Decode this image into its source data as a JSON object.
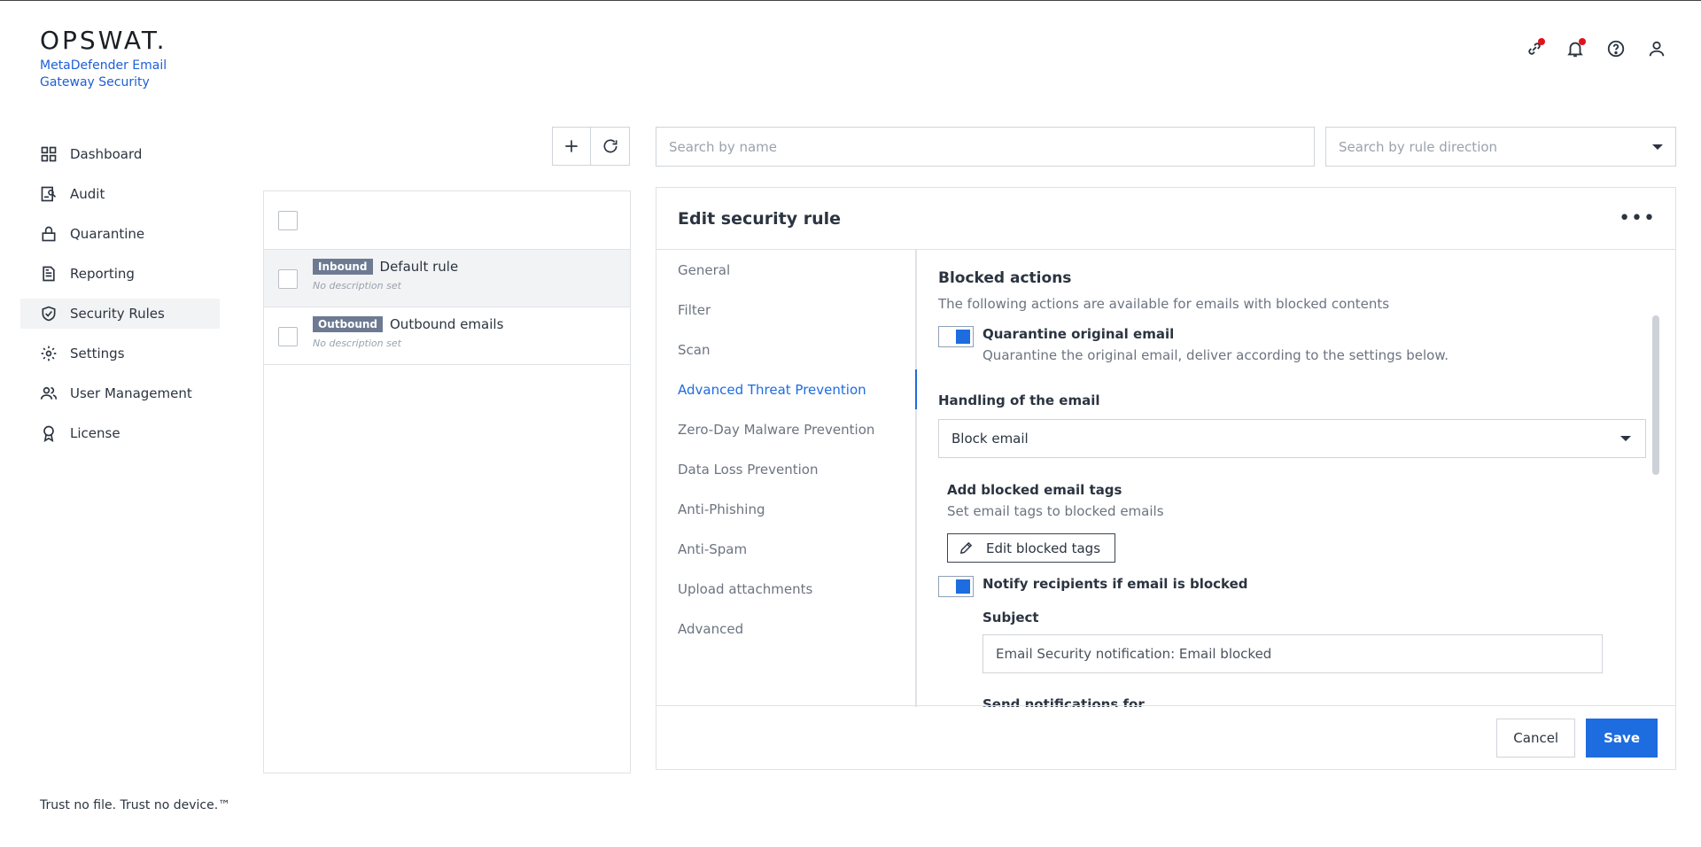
{
  "brand": {
    "logo": "OPSWAT.",
    "product": "MetaDefender Email Gateway Security"
  },
  "top_icons": [
    "link-icon",
    "bell-icon",
    "help-icon",
    "user-icon"
  ],
  "sidebar": {
    "items": [
      {
        "label": "Dashboard",
        "icon": "dashboard-icon"
      },
      {
        "label": "Audit",
        "icon": "audit-icon"
      },
      {
        "label": "Quarantine",
        "icon": "lock-icon"
      },
      {
        "label": "Reporting",
        "icon": "document-icon"
      },
      {
        "label": "Security Rules",
        "icon": "shield-check-icon",
        "active": true
      },
      {
        "label": "Settings",
        "icon": "gear-icon"
      },
      {
        "label": "User Management",
        "icon": "users-icon"
      },
      {
        "label": "License",
        "icon": "award-icon"
      }
    ],
    "footer": "Trust no file. Trust no device.™"
  },
  "rules": {
    "items": [
      {
        "direction": "Inbound",
        "name": "Default rule",
        "description": "No description set",
        "selected": true
      },
      {
        "direction": "Outbound",
        "name": "Outbound emails",
        "description": "No description set",
        "selected": false
      }
    ]
  },
  "search": {
    "name_placeholder": "Search by name",
    "direction_placeholder": "Search by rule direction"
  },
  "edit": {
    "title": "Edit security rule",
    "tabs": [
      "General",
      "Filter",
      "Scan",
      "Advanced Threat Prevention",
      "Zero-Day Malware Prevention",
      "Data Loss Prevention",
      "Anti-Phishing",
      "Anti-Spam",
      "Upload attachments",
      "Advanced"
    ],
    "active_tab": "Advanced Threat Prevention",
    "blocked_actions": {
      "title": "Blocked actions",
      "subtitle": "The following actions are available for emails with blocked contents",
      "quarantine_label": "Quarantine original email",
      "quarantine_desc": "Quarantine the original email, deliver according to the settings below.",
      "quarantine_on": true
    },
    "handling": {
      "label": "Handling of the email",
      "value": "Block email"
    },
    "tags": {
      "label": "Add blocked email tags",
      "desc": "Set email tags to blocked emails",
      "button": "Edit blocked tags"
    },
    "notify": {
      "label": "Notify recipients if email is blocked",
      "on": true,
      "subject_label": "Subject",
      "subject_value": "Email Security notification: Email blocked",
      "send_for_label": "Send notifications for"
    },
    "cancel_label": "Cancel",
    "save_label": "Save"
  }
}
